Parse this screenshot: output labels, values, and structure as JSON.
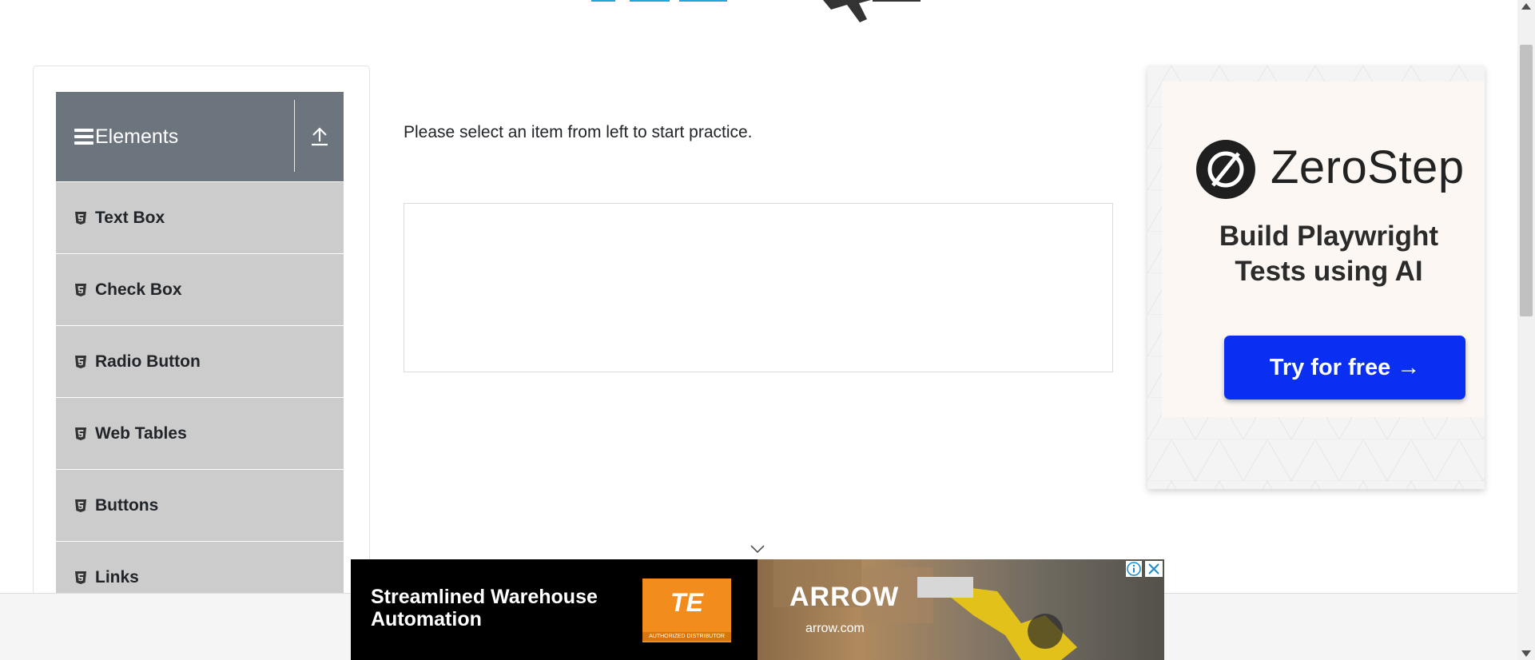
{
  "sidebar": {
    "group_title": "Elements",
    "items": [
      {
        "label": "Text Box",
        "icon": "html5-icon"
      },
      {
        "label": "Check Box",
        "icon": "html5-icon"
      },
      {
        "label": "Radio Button",
        "icon": "html5-icon"
      },
      {
        "label": "Web Tables",
        "icon": "html5-icon"
      },
      {
        "label": "Buttons",
        "icon": "html5-icon"
      },
      {
        "label": "Links",
        "icon": "html5-icon"
      }
    ]
  },
  "main": {
    "prompt": "Please select an item from left to start practice."
  },
  "side_ad": {
    "brand": "ZeroStep",
    "tagline_line1": "Build Playwright",
    "tagline_line2": "Tests using AI",
    "cta": "Try for free →",
    "cta_color": "#0a2ff0"
  },
  "bottom_ad": {
    "headline_line1": "Streamlined Warehouse",
    "headline_line2": "Automation",
    "te_logo": "TE",
    "te_sub": "AUTHORIZED DISTRIBUTOR",
    "arrow_brand": "ARROW",
    "arrow_url": "arrow.com"
  },
  "colors": {
    "group_header": "#6c757d",
    "menu_item": "#cccccc"
  }
}
